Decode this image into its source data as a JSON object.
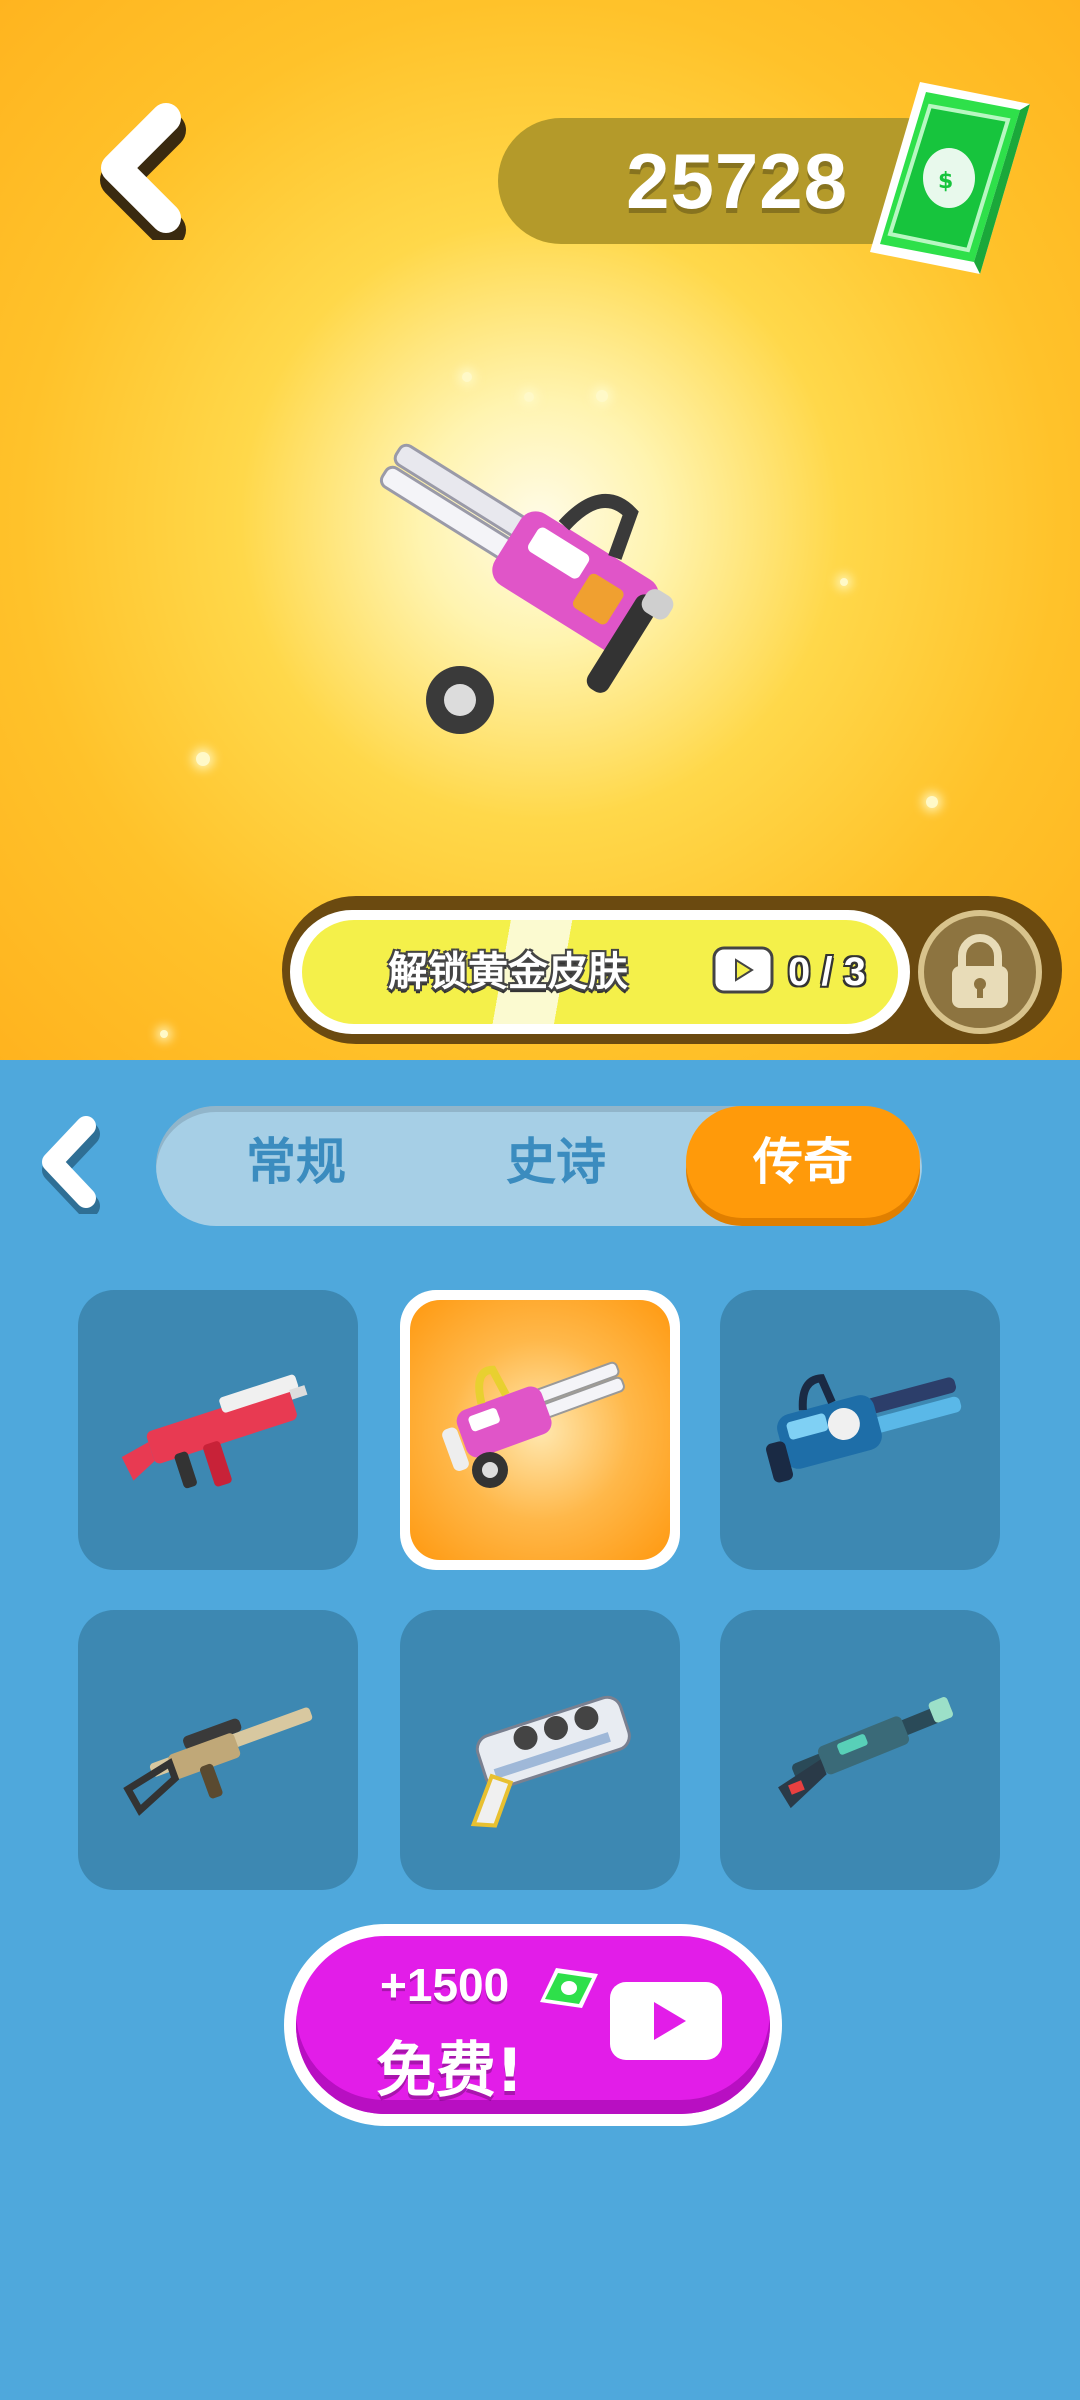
{
  "header": {
    "currency_amount": "25728",
    "currency_icon": "cash-icon"
  },
  "unlock": {
    "label": "解锁黄金皮肤",
    "progress": "0 / 3",
    "video_icon": "video-icon",
    "lock_icon": "lock-icon"
  },
  "tabs": [
    {
      "label": "常规",
      "active": false
    },
    {
      "label": "史诗",
      "active": false
    },
    {
      "label": "传奇",
      "active": true
    }
  ],
  "weapons": [
    {
      "name": "pink-red-smg",
      "selected": false
    },
    {
      "name": "pink-minigun",
      "selected": true
    },
    {
      "name": "blue-minigun",
      "selected": false
    },
    {
      "name": "camo-rifle",
      "selected": false
    },
    {
      "name": "white-plasma-gun",
      "selected": false
    },
    {
      "name": "teal-shotgun",
      "selected": false
    }
  ],
  "free_reward": {
    "amount": "+1500",
    "label": "免费!"
  },
  "colors": {
    "accent_orange": "#ff9a0a",
    "shop_blue": "#4fa8dc",
    "free_button_magenta": "#e21de8",
    "unlock_yellow": "#f4f04a"
  }
}
